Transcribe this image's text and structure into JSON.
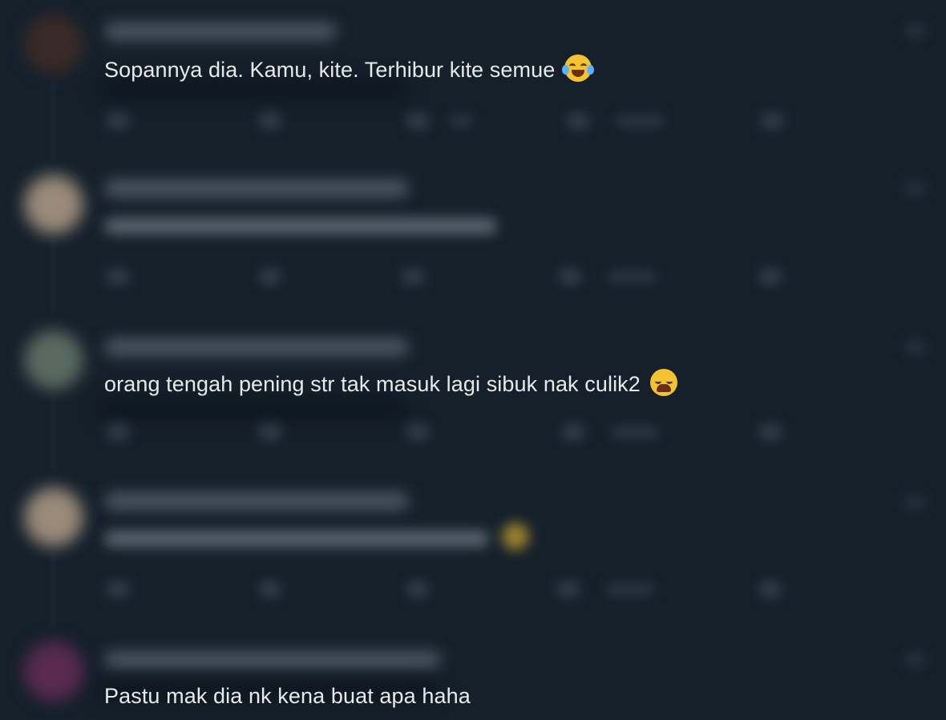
{
  "colors": {
    "background": "#15202b",
    "text": "#e7e9ea",
    "blurred_text": "#5a6570"
  },
  "feed": {
    "replies": [
      {
        "text": "Sopannya dia. Kamu, kite. Terhibur kite semue",
        "emoji": "face-with-tears-of-joy-icon",
        "readable": true
      },
      {
        "text": "",
        "readable": false
      },
      {
        "text": "orang tengah pening str tak masuk lagi sibuk nak culik2",
        "emoji": "weary-face-icon",
        "readable": true
      },
      {
        "text": "",
        "readable": false
      },
      {
        "text": "Pastu mak dia nk kena buat apa haha",
        "readable": true
      }
    ]
  }
}
